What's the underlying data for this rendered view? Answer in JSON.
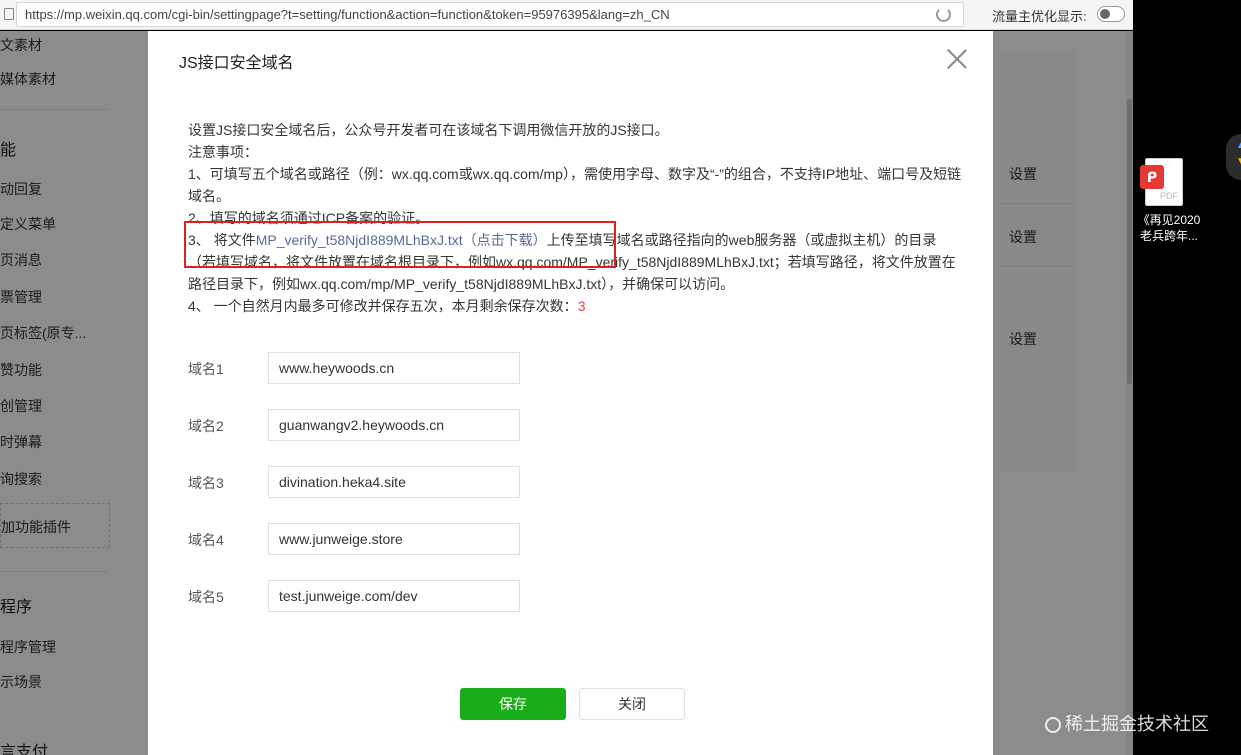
{
  "browser": {
    "url": "https://mp.weixin.qq.com/cgi-bin/settingpage?t=setting/function&action=function&token=95976395&lang=zh_CN",
    "traffic_optimization_label": "流量主优化显示:"
  },
  "sidebar": {
    "items": [
      {
        "label": "文素材"
      },
      {
        "label": "媒体素材"
      },
      {
        "label": "能"
      },
      {
        "label": "动回复"
      },
      {
        "label": "定义菜单"
      },
      {
        "label": "页消息"
      },
      {
        "label": "票管理"
      },
      {
        "label": "页标签(原专..."
      },
      {
        "label": "赞功能"
      },
      {
        "label": "创管理"
      },
      {
        "label": "时弹幕"
      },
      {
        "label": "询搜索"
      },
      {
        "label": "加功能插件"
      },
      {
        "label": "程序"
      },
      {
        "label": "程序管理"
      },
      {
        "label": "示场景"
      },
      {
        "label": "言支付"
      }
    ]
  },
  "background_settings": [
    "设置",
    "设置",
    "设置"
  ],
  "desktop": {
    "file_name": "《再见2020 老兵跨年...",
    "pdf_label": "PDF"
  },
  "dialog": {
    "title": "JS接口安全域名",
    "notes": {
      "intro": "设置JS接口安全域名后，公众号开发者可在该域名下调用微信开放的JS接口。",
      "heading": "注意事项：",
      "item1": "1、可填写五个域名或路径（例：wx.qq.com或wx.qq.com/mp），需使用字母、数字及“-”的组合，不支持IP地址、端口号及短链域名。",
      "item2": "2、填写的域名须通过ICP备案的验证。",
      "item3_prefix": "3、 将文件",
      "item3_file": "MP_verify_t58NjdI889MLhBxJ.txt",
      "item3_download": "（点击下载）",
      "item3_suffix": "上传至填写域名或路径指向的web服务器（或虚拟主机）的目录（若填写域名，将文件放置在域名根目录下，例如wx.qq.com/MP_verify_t58NjdI889MLhBxJ.txt；若填写路径，将文件放置在路径目录下，例如wx.qq.com/mp/MP_verify_t58NjdI889MLhBxJ.txt），并确保可以访问。",
      "item4_prefix": "4、 一个自然月内最多可修改并保存五次，本月剩余保存次数：",
      "item4_count": "3"
    },
    "fields": [
      {
        "label": "域名1",
        "value": "www.heywoods.cn"
      },
      {
        "label": "域名2",
        "value": "guanwangv2.heywoods.cn"
      },
      {
        "label": "域名3",
        "value": "divination.heka4.site"
      },
      {
        "label": "域名4",
        "value": "www.junweige.store"
      },
      {
        "label": "域名5",
        "value": "test.junweige.com/dev"
      }
    ],
    "save_label": "保存",
    "close_label": "关闭"
  },
  "watermark": "稀土掘金技术社区",
  "colors": {
    "primary_green": "#1aad19",
    "link_blue": "#576b95",
    "highlight_red": "#e02020"
  }
}
